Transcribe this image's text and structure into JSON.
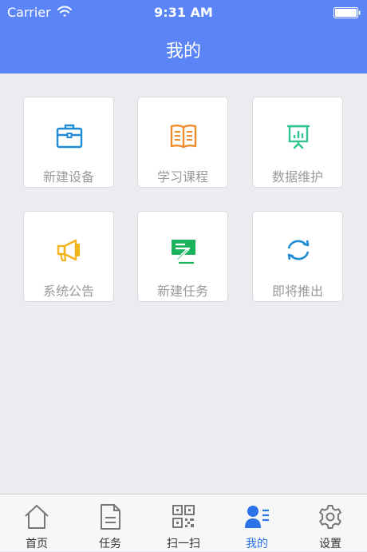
{
  "status_bar": {
    "carrier": "Carrier",
    "time": "9:31 AM"
  },
  "header": {
    "title": "我的"
  },
  "grid": [
    {
      "label": "新建设备",
      "icon": "briefcase-icon",
      "color": "#1f8bd6"
    },
    {
      "label": "学习课程",
      "icon": "open-book-icon",
      "color": "#f08b2a"
    },
    {
      "label": "数据维护",
      "icon": "presentation-chart-icon",
      "color": "#2fc58d"
    },
    {
      "label": "系统公告",
      "icon": "megaphone-icon",
      "color": "#f2b31b"
    },
    {
      "label": "新建任务",
      "icon": "new-task-icon",
      "color": "#19b35b"
    },
    {
      "label": "即将推出",
      "icon": "refresh-icon",
      "color": "#1f8bd6"
    }
  ],
  "tabbar": {
    "items": [
      {
        "label": "首页",
        "icon": "home-icon"
      },
      {
        "label": "任务",
        "icon": "document-icon"
      },
      {
        "label": "扫一扫",
        "icon": "qr-code-icon"
      },
      {
        "label": "我的",
        "icon": "user-profile-icon",
        "active": true
      },
      {
        "label": "设置",
        "icon": "gear-icon"
      }
    ],
    "active_color": "#2a72e5"
  }
}
